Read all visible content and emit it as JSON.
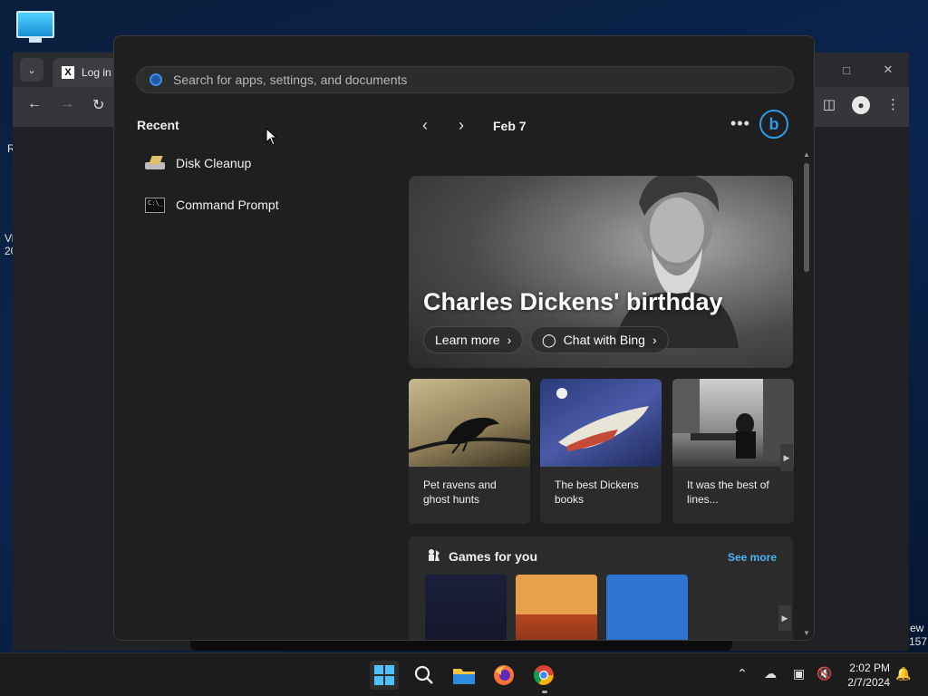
{
  "browser": {
    "tab_title": "Log in t",
    "edge_left_1": "R",
    "edge_left_2": "Vi",
    "edge_left_3": "20",
    "edge_right_1": "ew",
    "edge_right_2": "157"
  },
  "start_menu": {
    "search_placeholder": "Search for apps, settings, and documents",
    "recent_heading": "Recent",
    "recent_items": [
      {
        "label": "Disk Cleanup",
        "icon": "disk-cleanup-icon"
      },
      {
        "label": "Command Prompt",
        "icon": "command-prompt-icon"
      }
    ]
  },
  "widgets": {
    "date": "Feb 7",
    "hero": {
      "title": "Charles Dickens' birthday",
      "learn_more": "Learn more",
      "chat_with_bing": "Chat with Bing"
    },
    "cards": [
      {
        "text": "Pet ravens and ghost hunts"
      },
      {
        "text": "The best Dickens books"
      },
      {
        "text": "It was the best of lines..."
      }
    ],
    "games": {
      "title": "Games for you",
      "see_more": "See more",
      "tile_colors": [
        "#1b1f3a",
        "#e8a04a",
        "#2f74d0"
      ]
    }
  },
  "taskbar": {
    "clock_time": "2:02 PM",
    "clock_date": "2/7/2024"
  },
  "colors": {
    "accent": "#2d9be8",
    "link": "#4cb5f5",
    "panel": "#1f1f1f"
  }
}
